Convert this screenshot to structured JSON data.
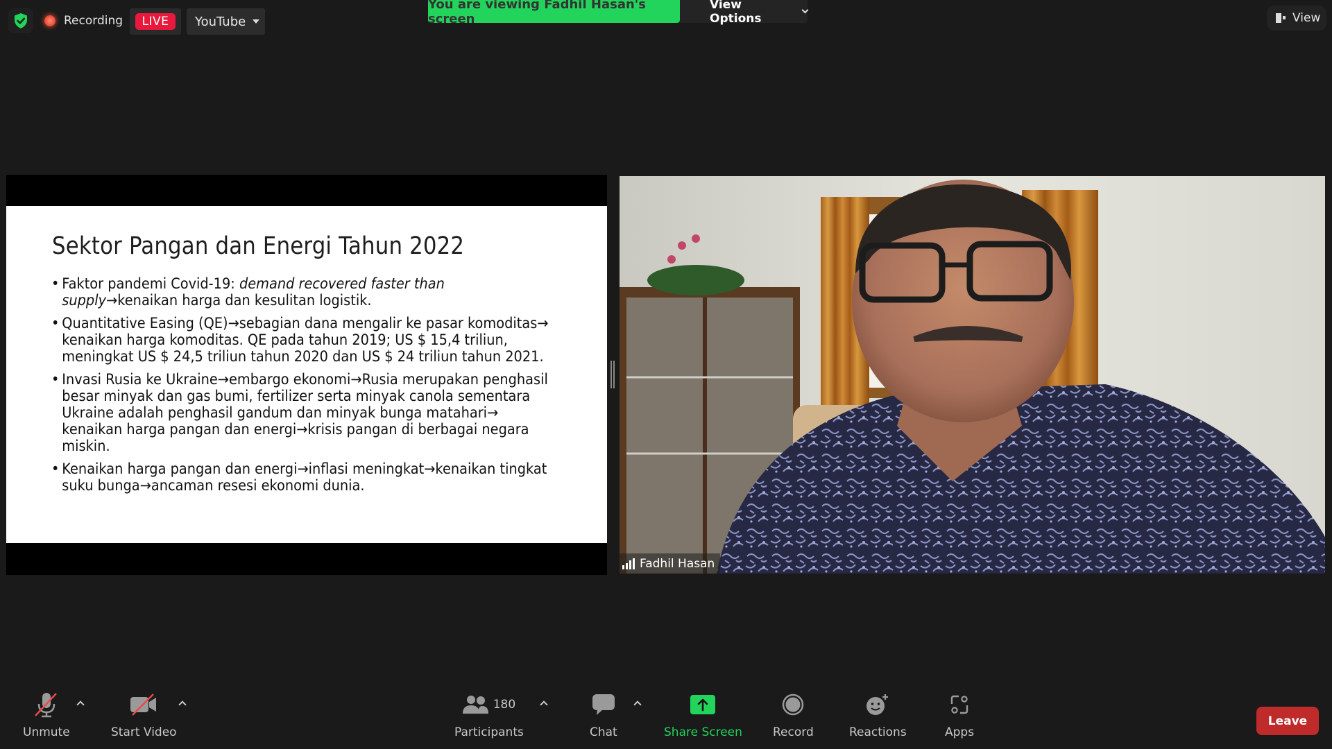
{
  "top_bar": {
    "recording_label": "Recording",
    "live_badge": "LIVE",
    "stream_target": "YouTube",
    "viewing_banner": "You are viewing Fadhil Hasan's screen",
    "view_options_label": "View Options",
    "view_label": "View"
  },
  "colors": {
    "banner_green": "#22d45b",
    "live_red": "#e8193c",
    "leave_red": "#bf2a2a",
    "muted_slash_red": "#e84a4a",
    "background": "#1a1a1a"
  },
  "shared_slide": {
    "title": "Sektor Pangan dan Energi Tahun 2022",
    "bullets": [
      {
        "plain_prefix": "Faktor pandemi Covid-19: ",
        "italic": "demand recovered faster than supply",
        "suffix": "→kenaikan harga dan kesulitan logistik."
      },
      {
        "text": "Quantitative Easing (QE)→sebagian dana mengalir ke pasar komoditas→ kenaikan harga komoditas.  QE pada tahun 2019; US $ 15,4 triliun, meningkat US $ 24,5 triliun tahun 2020 dan US $ 24 triliun tahun 2021."
      },
      {
        "text": "Invasi Rusia ke Ukraine→embargo ekonomi→Rusia merupakan penghasil besar minyak dan gas bumi, fertilizer serta minyak canola sementara Ukraine adalah penghasil gandum dan minyak bunga matahari→ kenaikan harga pangan dan energi→krisis pangan di berbagai negara miskin."
      },
      {
        "text": "Kenaikan harga pangan dan energi→inflasi meningkat→kenaikan tingkat suku bunga→ancaman resesi ekonomi dunia."
      }
    ]
  },
  "video": {
    "participant_name": "Fadhil Hasan",
    "signal_icon": "signal-bars-icon"
  },
  "toolbar": {
    "unmute_label": "Unmute",
    "start_video_label": "Start Video",
    "participants_label": "Participants",
    "participants_count": "180",
    "chat_label": "Chat",
    "share_screen_label": "Share Screen",
    "record_label": "Record",
    "reactions_label": "Reactions",
    "apps_label": "Apps",
    "leave_label": "Leave"
  }
}
